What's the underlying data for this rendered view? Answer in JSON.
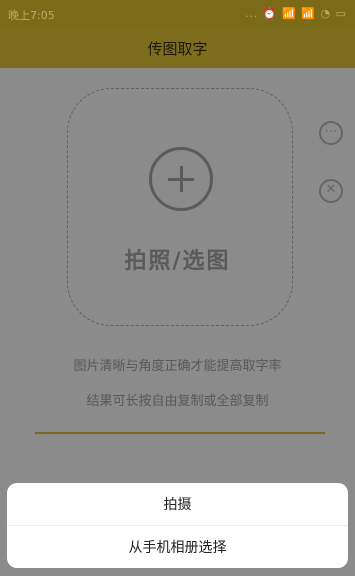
{
  "status_bar": {
    "time": "晚上7:05",
    "icons_text": "... ⏰ 📶 📶 ◔ ▭"
  },
  "header": {
    "title": "传图取字"
  },
  "upload": {
    "label": "拍照/选图",
    "plus_icon": "plus-circle-icon"
  },
  "side_icons": {
    "more": "⋯",
    "close": "✕"
  },
  "tips": [
    "图片清晰与角度正确才能提高取字率",
    "结果可长按自由复制或全部复制"
  ],
  "action_sheet": {
    "items": [
      "拍摄",
      "从手机相册选择"
    ]
  },
  "colors": {
    "accent": "#7d6d1d",
    "overlay": "#8b8b8b",
    "sheet_bg": "#ffffff"
  }
}
